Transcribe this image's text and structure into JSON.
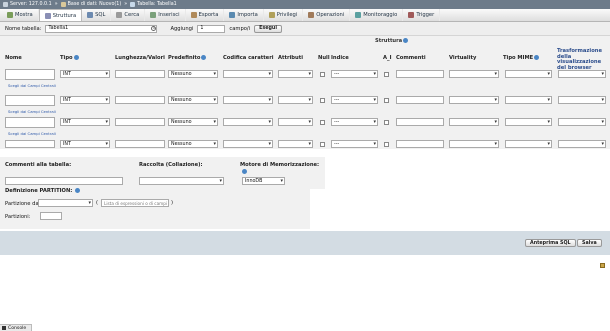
{
  "breadcrumb": {
    "server": "Server: 127.0.0.1",
    "database": "Base di dati: Nuovo(1)",
    "table": "Tabella: Tabella1"
  },
  "tabs": [
    {
      "label": "Mostra",
      "icon": "browse-icon"
    },
    {
      "label": "Struttura",
      "icon": "structure-icon",
      "active": true
    },
    {
      "label": "SQL",
      "icon": "sql-icon"
    },
    {
      "label": "Cerca",
      "icon": "search-icon"
    },
    {
      "label": "Inserisci",
      "icon": "insert-icon"
    },
    {
      "label": "Esporta",
      "icon": "export-icon"
    },
    {
      "label": "Importa",
      "icon": "import-icon"
    },
    {
      "label": "Privilegi",
      "icon": "privileges-icon"
    },
    {
      "label": "Operazioni",
      "icon": "operations-icon"
    },
    {
      "label": "Monitoraggio",
      "icon": "tracking-icon"
    },
    {
      "label": "Trigger",
      "icon": "trigger-icon"
    }
  ],
  "namebar": {
    "table_name_label": "Nome tabella:",
    "table_name_value": "Tabella1",
    "add_label": "Aggiungi",
    "add_count": "1",
    "columns_label": "campo/i",
    "go_button": "Esegui"
  },
  "structure": {
    "title": "Struttura",
    "headers": {
      "name": "Nome",
      "type": "Tipo",
      "length": "Lunghezza/Valori",
      "default": "Predefinito",
      "collation": "Codifica caratteri",
      "attributes": "Attributi",
      "null": "Null",
      "index": "Indice",
      "ai": "A_I",
      "comments": "Commenti",
      "virtuality": "Virtuality",
      "mime": "Tipo MIME",
      "transformation": "Trasformazione della visualizzazione del browser"
    },
    "pick_central_link": "Scegli dai Campi Centrali",
    "rows": [
      {
        "type": "INT",
        "default": "Nessuno",
        "index": "---"
      },
      {
        "type": "INT",
        "default": "Nessuno",
        "index": "---"
      },
      {
        "type": "INT",
        "default": "Nessuno",
        "index": "---"
      },
      {
        "type": "INT",
        "default": "Nessuno",
        "index": "---"
      }
    ]
  },
  "table_options": {
    "comments_label": "Commenti alla tabella:",
    "collation_label": "Raccolta (Collazione):",
    "engine_label": "Motore di Memorizzazione:",
    "engine_value": "InnoDB"
  },
  "partition": {
    "title": "Definizione PARTITION:",
    "partition_by_label": "Partizione da:",
    "expression_placeholder": "Lista di espressioni o di campi",
    "partitions_label": "Partizioni:"
  },
  "actions": {
    "preview_sql": "Anteprima SQL",
    "save": "Salva"
  },
  "console": {
    "label": "Console"
  },
  "colors": {
    "topbar": "#6d7b8a",
    "action_band": "#d3dce3",
    "band": "#f1f1f1",
    "help_icon": "#4a86c5"
  }
}
